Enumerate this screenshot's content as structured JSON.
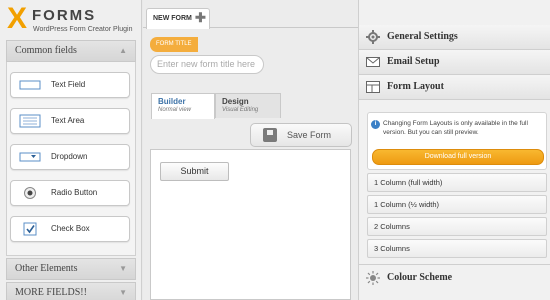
{
  "brand": {
    "logo_x": "X",
    "logo_word": "FORMS",
    "subtitle": "WordPress Form Creator Plugin"
  },
  "sidebar": {
    "common_fields_title": "Common fields",
    "fields": [
      {
        "label": "Text Field",
        "icon": "text-field-icon"
      },
      {
        "label": "Text Area",
        "icon": "text-area-icon"
      },
      {
        "label": "Dropdown",
        "icon": "dropdown-icon"
      },
      {
        "label": "Radio Button",
        "icon": "radio-button-icon"
      },
      {
        "label": "Check Box",
        "icon": "checkbox-icon"
      }
    ],
    "other_elements_title": "Other Elements",
    "more_fields_title": "MORE FIELDS!!"
  },
  "editor": {
    "new_form_tab": "NEW FORM",
    "form_title_label": "FORM TITLE",
    "form_title_placeholder": "Enter new form title here",
    "builder_tab": {
      "title": "Builder",
      "subtitle": "Normal view"
    },
    "design_tab": {
      "title": "Design",
      "subtitle": "Visual Editing"
    },
    "save_label": "Save Form",
    "submit_label": "Submit"
  },
  "settings": {
    "general_settings": "General Settings",
    "email_setup": "Email Setup",
    "form_layout": "Form Layout",
    "info_text": "Changing Form Layouts is only available in the full version. But you can still preview.",
    "download_label": "Download full version",
    "layouts": [
      "1 Column (full width)",
      "1 Column (½ width)",
      "2 Columns",
      "3 Columns"
    ],
    "colour_scheme": "Colour Scheme"
  },
  "colors": {
    "accent_orange": "#f4ad3d",
    "download_orange": "#f0a020",
    "tab_blue": "#3d73a8",
    "info_blue": "#3b80c6"
  }
}
